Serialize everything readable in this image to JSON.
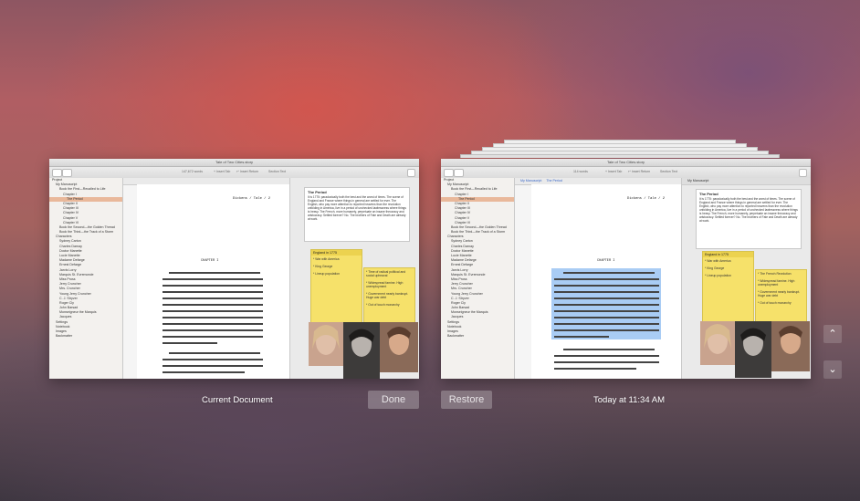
{
  "left_snapshot": {
    "window_title": "Tale of Two Cities.story",
    "toolbar_info": [
      "147,672 words",
      "+ Insert Tab",
      "↵ Insert Return",
      "Section Text"
    ],
    "editor_header": "The Period",
    "page_title": "Dickens / Tale / 2",
    "chapter_title": "CHAPTER I",
    "caption": "Current Document"
  },
  "right_snapshot": {
    "window_title": "Tale of Two Cities.story",
    "toolbar_info": [
      "114 words",
      "+ Insert Tab",
      "↵ Insert Return",
      "Section Text"
    ],
    "editor_header_left": "My Manuscript",
    "editor_header_right": "The Period",
    "page_title": "Dickens / Tale / 2",
    "chapter_title": "CHAPTER I",
    "caption": "Today at 11:34 AM"
  },
  "binder": {
    "items": [
      "Project",
      "My Manuscript",
      "Book the First—Recalled to Life",
      "Chapter I",
      "The Period",
      "Chapter II",
      "Chapter III",
      "Chapter IV",
      "Chapter V",
      "Chapter VI",
      "Book the Second—the Golden Thread",
      "Book the Third—the Track of a Storm",
      "Characters",
      "Sydney Carton",
      "Charles Darnay",
      "Doctor Manette",
      "Lucie Manette",
      "Madame Defarge",
      "Ernest Defarge",
      "Jarvis Lorry",
      "Marquis St. Evremonde",
      "Miss Pross",
      "Jerry Cruncher",
      "Mrs. Cruncher",
      "Young Jerry Cruncher",
      "C. J. Stryver",
      "Roger Cly",
      "John Barsad",
      "Monseigneur the Marquis",
      "Jacques",
      "Settings",
      "Notebook",
      "Images",
      "Backmatter"
    ]
  },
  "inspector": {
    "synopsis_title": "The Period",
    "synopsis_text": "It is 1775: paradoxically both the best and the worst of times. The scene of England and France where things in general are settled for ever. The English, who pay more attention to reported heavens than the revolution unfolding in America, live in a period of unchecked lawlessness where things is heavy. The French, more humanely, perpetuate an insane theocracy and aristocracy. Settled forever? No. The brothers of Fate and Death are already at work.",
    "note_header": "England in 1775",
    "notes": [
      "* War with America",
      "* King George",
      "* Lineup population",
      "* The French Revolution",
      "* Time of radical political and social upheaval",
      "* Widespread famine. High unemployment",
      "* Government nearly bankrupt. Huge war debt",
      "* Out of touch monarchy"
    ]
  },
  "controls": {
    "done_label": "Done",
    "restore_label": "Restore",
    "up_icon": "⌃",
    "down_icon": "⌄"
  }
}
